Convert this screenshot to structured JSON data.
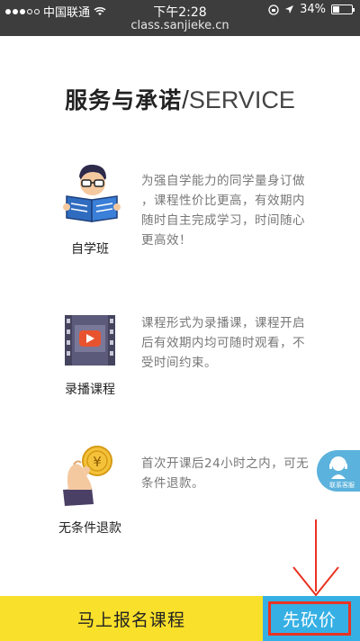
{
  "status_bar": {
    "carrier": "中国联通",
    "time": "下午2:28",
    "battery": "34%",
    "url": "class.sanjieke.cn"
  },
  "heading": {
    "cn": "服务与承诺",
    "slash": "/",
    "en": "SERVICE"
  },
  "features": [
    {
      "label": "自学班",
      "icon": "reader-icon",
      "desc_lines": [
        "为强自学能力的同学量身订做",
        "，课程性价比更高，有效期内",
        "随时自主完成学习，时间随心",
        "更高效！"
      ]
    },
    {
      "label": "录播课程",
      "icon": "video-film-icon",
      "desc_lines": [
        "课程形式为录播课，课程开启",
        "后有效期内均可随时观看，不",
        "受时间约束。"
      ]
    },
    {
      "label": "无条件退款",
      "icon": "coin-refund-icon",
      "desc_lines": [
        "首次开课后24小时之内，可无",
        "条件退款。"
      ]
    }
  ],
  "service_float": {
    "label": "联系客服"
  },
  "bottom_bar": {
    "enroll_label": "马上报名课程",
    "bargain_label": "先砍价"
  },
  "colors": {
    "status_bar": "#3d3d3d",
    "enroll_bg": "#f9e02b",
    "bargain_bg": "#36b0e4",
    "highlight_red": "#e93323",
    "service_blue": "#5bb2dc"
  }
}
